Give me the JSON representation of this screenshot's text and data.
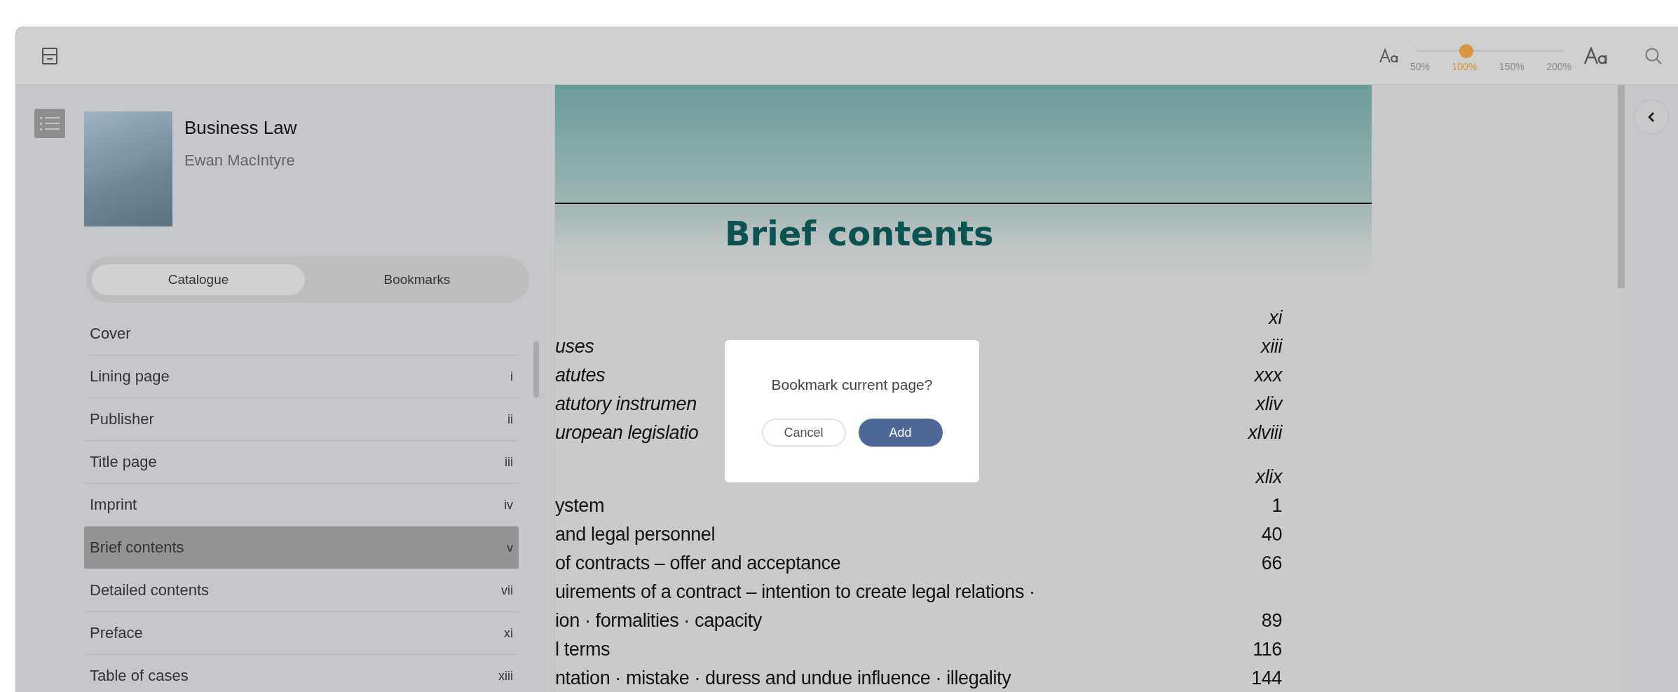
{
  "toolbar": {
    "font_size": {
      "level": 0.333,
      "marks": [
        {
          "label": "50%",
          "selected": false
        },
        {
          "label": "100%",
          "selected": true
        },
        {
          "label": "150%",
          "selected": false
        },
        {
          "label": "200%",
          "selected": false
        }
      ]
    }
  },
  "sidebar": {
    "book": {
      "title": "Business Law",
      "author": "Ewan MacIntyre"
    },
    "tabs": [
      {
        "label": "Catalogue",
        "selected": true
      },
      {
        "label": "Bookmarks",
        "selected": false
      }
    ],
    "items": [
      {
        "label": "Cover",
        "selected": false
      },
      {
        "label": "Lining page",
        "page": "i",
        "selected": false
      },
      {
        "label": "Publisher",
        "page": "ii",
        "selected": false
      },
      {
        "label": "Title page",
        "page": "iii",
        "selected": false
      },
      {
        "label": "Imprint",
        "page": "iv",
        "selected": false
      },
      {
        "label": "Brief contents",
        "page": "v",
        "selected": true
      },
      {
        "label": "Detailed contents",
        "page": "vii",
        "selected": false
      },
      {
        "label": "Preface",
        "page": "xi",
        "selected": false
      },
      {
        "label": "Table of cases",
        "page": "xiii",
        "selected": false
      }
    ]
  },
  "page": {
    "heading": "Brief contents",
    "entries": [
      {
        "page": "xi",
        "italic": true
      },
      {
        "text": "uses",
        "page": "xiii",
        "italic": true
      },
      {
        "text": "atutes",
        "page": "xxx",
        "italic": true
      },
      {
        "text": "atutory instrumen",
        "page": "xliv",
        "italic": true
      },
      {
        "text": "uropean legislatio",
        "page": "xlviii",
        "italic": true
      },
      {
        "page": "xlix",
        "italic": true,
        "gap": true
      },
      {
        "text": "ystem",
        "page": "1",
        "italic": false
      },
      {
        "text": "and legal personnel",
        "page": "40",
        "italic": false
      },
      {
        "text": "of contracts – offer and acceptance",
        "page": "66",
        "italic": false
      },
      {
        "text": "uirements of a contract – intention to create legal relations ·",
        "italic": false
      },
      {
        "text": "ion · formalities · capacity",
        "page": "89",
        "italic": false
      },
      {
        "text": "l terms",
        "page": "116",
        "italic": false
      },
      {
        "text": "ntation · mistake · duress and undue influence · illegality",
        "page": "144",
        "italic": false
      }
    ]
  },
  "dialog": {
    "message": "Bookmark current page?",
    "buttons": [
      {
        "label": "Cancel",
        "kind": "secondary"
      },
      {
        "label": "Add",
        "kind": "primary"
      }
    ]
  }
}
